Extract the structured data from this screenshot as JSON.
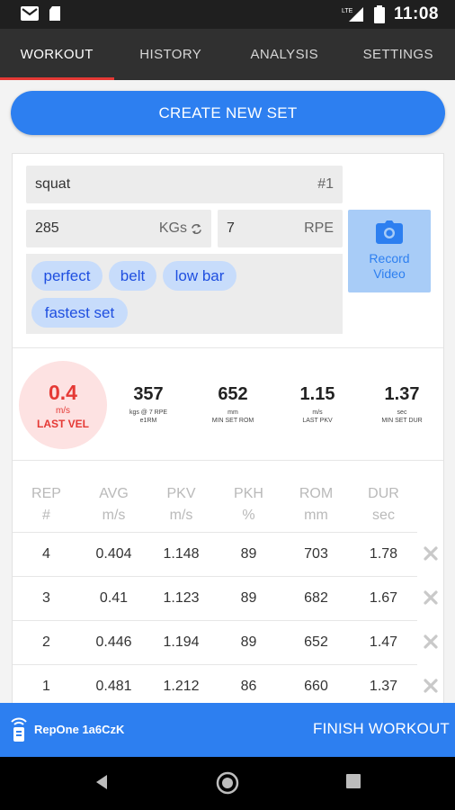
{
  "status_bar": {
    "time": "11:08",
    "network": "LTE"
  },
  "tabs": [
    {
      "label": "WORKOUT",
      "active": true
    },
    {
      "label": "HISTORY",
      "active": false
    },
    {
      "label": "ANALYSIS",
      "active": false
    },
    {
      "label": "SETTINGS",
      "active": false
    }
  ],
  "create_button": "CREATE NEW SET",
  "set": {
    "exercise": "squat",
    "number": "#1",
    "weight": "285",
    "weight_unit": "KGs",
    "rpe": "7",
    "rpe_label": "RPE",
    "tags": [
      "perfect",
      "belt",
      "low bar",
      "fastest set"
    ],
    "record_video": {
      "line1": "Record",
      "line2": "Video"
    }
  },
  "stats": {
    "last_vel": {
      "value": "0.4",
      "unit": "m/s",
      "label": "LAST VEL"
    },
    "e1rm": {
      "value": "357",
      "line1": "kgs @ 7 RPE",
      "line2": "e1RM"
    },
    "min_rom": {
      "value": "652",
      "line1": "mm",
      "line2": "MIN SET ROM"
    },
    "last_pkv": {
      "value": "1.15",
      "line1": "m/s",
      "line2": "LAST PKV"
    },
    "min_dur": {
      "value": "1.37",
      "line1": "sec",
      "line2": "MIN SET DUR"
    }
  },
  "table": {
    "headers": [
      {
        "top": "REP",
        "bottom": "#"
      },
      {
        "top": "AVG",
        "bottom": "m/s"
      },
      {
        "top": "PKV",
        "bottom": "m/s"
      },
      {
        "top": "PKH",
        "bottom": "%"
      },
      {
        "top": "ROM",
        "bottom": "mm"
      },
      {
        "top": "DUR",
        "bottom": "sec"
      }
    ],
    "rows": [
      [
        "4",
        "0.404",
        "1.148",
        "89",
        "703",
        "1.78"
      ],
      [
        "3",
        "0.41",
        "1.123",
        "89",
        "682",
        "1.67"
      ],
      [
        "2",
        "0.446",
        "1.194",
        "89",
        "652",
        "1.47"
      ],
      [
        "1",
        "0.481",
        "1.212",
        "86",
        "660",
        "1.37"
      ]
    ]
  },
  "bottom_bar": {
    "device": "RepOne 1a6CzK",
    "finish": "FINISH WORKOUT"
  },
  "colors": {
    "accent": "#2d7ff0",
    "tab_indicator": "#e53935",
    "chip_bg": "#c7dcfb",
    "chip_text": "#1f4fe0",
    "velocity_red": "#e53935"
  }
}
